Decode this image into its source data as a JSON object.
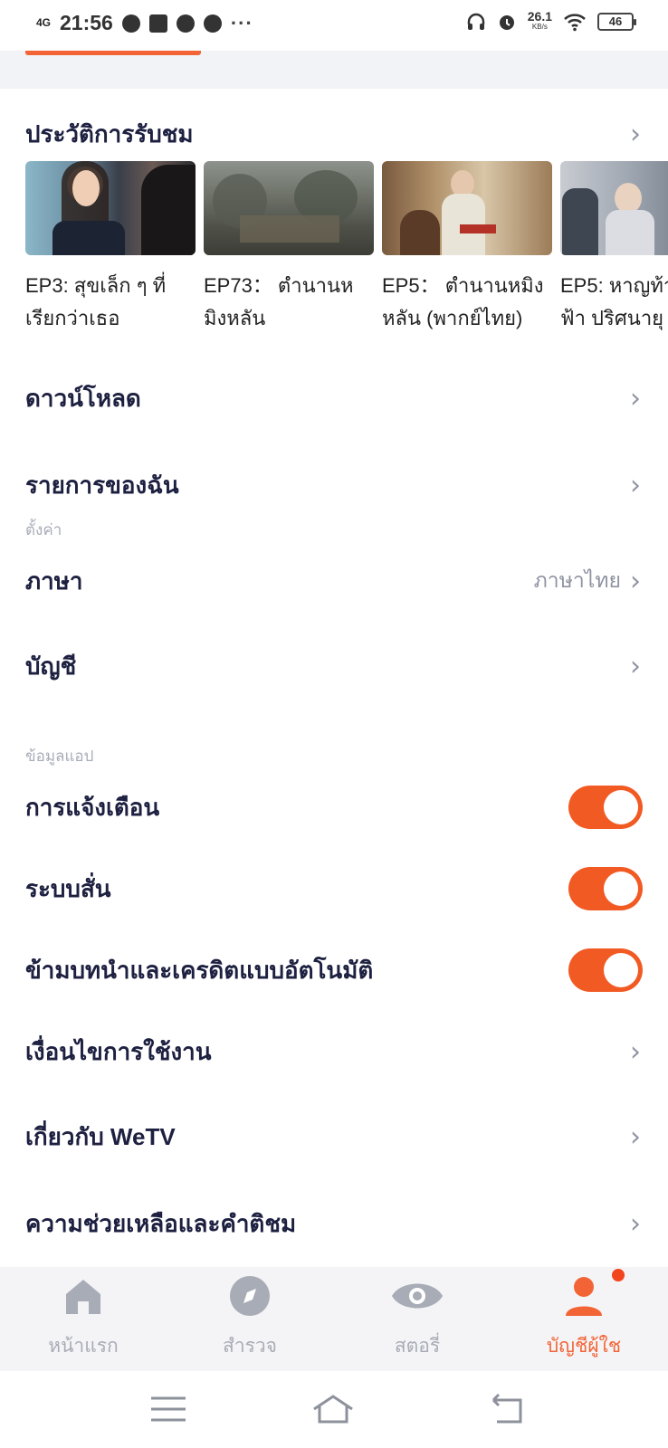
{
  "status_bar": {
    "network": "4G",
    "time": "21:56",
    "speed": "26.1",
    "speed_unit": "KB/s",
    "battery": "46",
    "more": "···"
  },
  "history": {
    "title": "ประวัติการรับชม",
    "items": [
      {
        "title": "EP3: สุขเล็ก ๆ ที่\nเรียกว่าเธอ"
      },
      {
        "title": "EP73：  ตำนานห\nมิงหลัน"
      },
      {
        "title": "EP5：  ตำนานหมิง\nหลัน  (พากย์ไทย)"
      },
      {
        "title": "EP5: หาญท้า\nฟ้า ปริศนายุ"
      }
    ]
  },
  "menu": {
    "download": "ดาวน์โหลด",
    "my_list": "รายการของฉัน"
  },
  "settings": {
    "section_label": "ตั้งค่า",
    "language_label": "ภาษา",
    "language_value": "ภาษาไทย",
    "account_label": "บัญชี"
  },
  "app_info": {
    "section_label": "ข้อมูลแอป",
    "notifications": "การแจ้งเตือน",
    "vibration": "ระบบสั่น",
    "skip_intro": "ข้ามบทนำและเครดิตแบบอัตโนมัติ",
    "terms": "เงื่อนไขการใช้งาน",
    "about": "เกี่ยวกับ WeTV",
    "help": "ความช่วยเหลือและคำติชม"
  },
  "toggles": {
    "notifications_on": true,
    "vibration_on": true,
    "skip_intro_on": true
  },
  "bottom_nav": {
    "home": "หน้าแรก",
    "explore": "สำรวจ",
    "story": "สตอรี่",
    "account": "บัญชีผู้ใช"
  },
  "colors": {
    "accent": "#f26436",
    "toggle_on": "#f25a24",
    "text_primary": "#1d2040",
    "text_secondary": "#8e93a1"
  }
}
